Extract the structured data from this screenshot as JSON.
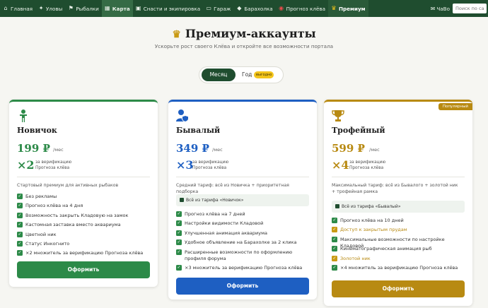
{
  "nav": {
    "items": [
      {
        "label": "Главная",
        "icon": "home-icon"
      },
      {
        "label": "Уловы",
        "icon": "fish-icon"
      },
      {
        "label": "Рыбалки",
        "icon": "flag-icon"
      },
      {
        "label": "Карта",
        "icon": "map-icon"
      },
      {
        "label": "Снасти и экипировка",
        "icon": "tackle-icon"
      },
      {
        "label": "Гараж",
        "icon": "car-icon"
      },
      {
        "label": "Барахолка",
        "icon": "tag-icon"
      },
      {
        "label": "Прогноз клёва",
        "icon": "forecast-icon"
      },
      {
        "label": "Премиум",
        "icon": "crown-icon"
      }
    ],
    "chat": "ЧаВо",
    "search_placeholder": "Поиск по сай"
  },
  "hero": {
    "title": "Премиум-аккаунты",
    "subtitle": "Ускорьте рост своего Клёва и откройте все возможности портала"
  },
  "toggle": {
    "month": "Месяц",
    "year": "Год",
    "year_badge": "выгодно"
  },
  "cards": [
    {
      "name": "Новичок",
      "price": "199 ₽",
      "per": "/мес",
      "mult": "×2",
      "mult_text": "за верификацию Прогноза клёва",
      "desc": "Стартовый премиум для активных рыбаков",
      "features": [
        "Без рекламы",
        "Прогноз клёва на 4 дня",
        "Возможность закрыть Кладовую на замок",
        "Кастомная заставка вместо аквариума",
        "Цветной ник",
        "Статус Инкогнито",
        "×2 множитель за верификацию Прогноза клёва"
      ],
      "button": "Оформить"
    },
    {
      "name": "Бывалый",
      "price": "349 ₽",
      "per": "/мес",
      "mult": "×3",
      "mult_text": "за верификацию Прогноза клёва",
      "desc": "Средний тариф: всё из Новичка + приоритетная подборка",
      "inherit": "Всё из тарифа «Новичок»",
      "features": [
        "Прогноз клёва на 7 дней",
        "Настройки видимости Кладовой",
        "Улучшенная анимация аквариума",
        "Удобное объявление на Барахолке за 2 клика",
        "Расширенные возможности по оформлению профиля форума",
        "×3 множитель за верификацию Прогноза клёва"
      ],
      "button": "Оформить"
    },
    {
      "name": "Трофейный",
      "badge": "Популярный",
      "price": "599 ₽",
      "per": "/мес",
      "mult": "×4",
      "mult_text": "за верификацию Прогноза клёва",
      "desc": "Максимальный тариф: всё из Бывалого + золотой ник + трофейная рамка",
      "inherit": "Всё из тарифа «Бывалый»",
      "features": [
        "Прогноз клёва на 10 дней",
        "Доступ к закрытым прудам",
        "Максимальные возможности по настройке Кладовой",
        "Кинематографическая анимация рыб",
        "Золотой ник",
        "×4 множитель за верификацию Прогноза клёва"
      ],
      "button": "Оформить"
    }
  ],
  "colors": {
    "nav_bg": "#1f4d2f",
    "green": "#2c8a48",
    "blue": "#1e5fc2",
    "gold": "#b88a12"
  }
}
